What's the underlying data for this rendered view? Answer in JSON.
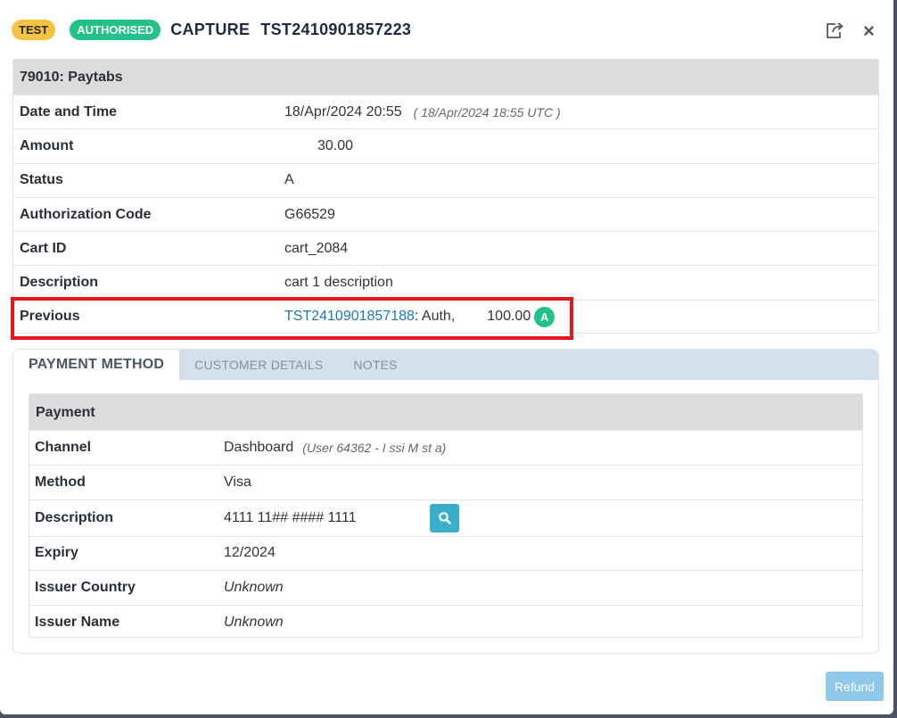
{
  "header": {
    "test_badge": "TEST",
    "status_badge": "AUTHORISED",
    "transaction_type": "CAPTURE",
    "transaction_id": "TST2410901857223"
  },
  "summary": {
    "heading": "79010: Paytabs",
    "rows": [
      {
        "label": "Date and Time",
        "value": "18/Apr/2024 20:55",
        "note": "( 18/Apr/2024 18:55 UTC )"
      },
      {
        "label": "Amount",
        "value": "30.00"
      },
      {
        "label": "Status",
        "value": "A"
      },
      {
        "label": "Authorization Code",
        "value": "G66529"
      },
      {
        "label": "Cart ID",
        "value": "cart_2084"
      },
      {
        "label": "Description",
        "value": "cart 1 description"
      }
    ],
    "previous": {
      "label": "Previous",
      "link": "TST2410901857188",
      "suffix": ": Auth,",
      "amount": "100.00",
      "status": "A"
    }
  },
  "tabs": [
    {
      "label": "PAYMENT METHOD",
      "active": true
    },
    {
      "label": "CUSTOMER DETAILS",
      "active": false
    },
    {
      "label": "NOTES",
      "active": false
    }
  ],
  "payment": {
    "heading": "Payment",
    "channel": {
      "label": "Channel",
      "value": "Dashboard",
      "note": "(User 64362 - I  ssi    M  st  a)"
    },
    "method": {
      "label": "Method",
      "value": "Visa"
    },
    "description": {
      "label": "Description",
      "value": "4111 11## #### 1111"
    },
    "expiry": {
      "label": "Expiry",
      "value": "12/2024"
    },
    "issuer_country": {
      "label": "Issuer Country",
      "value": "Unknown"
    },
    "issuer_name": {
      "label": "Issuer Name",
      "value": "Unknown"
    }
  },
  "actions": {
    "refund_label": "Refund"
  },
  "colors": {
    "test_badge": "#f5c242",
    "authorised_badge": "#22c187",
    "link": "#1b78b8",
    "highlight": "#e8141c",
    "refund_button": "#8ec8ea",
    "search_button": "#3aafc9"
  },
  "icons": [
    "share-icon",
    "close-icon",
    "search-icon"
  ]
}
